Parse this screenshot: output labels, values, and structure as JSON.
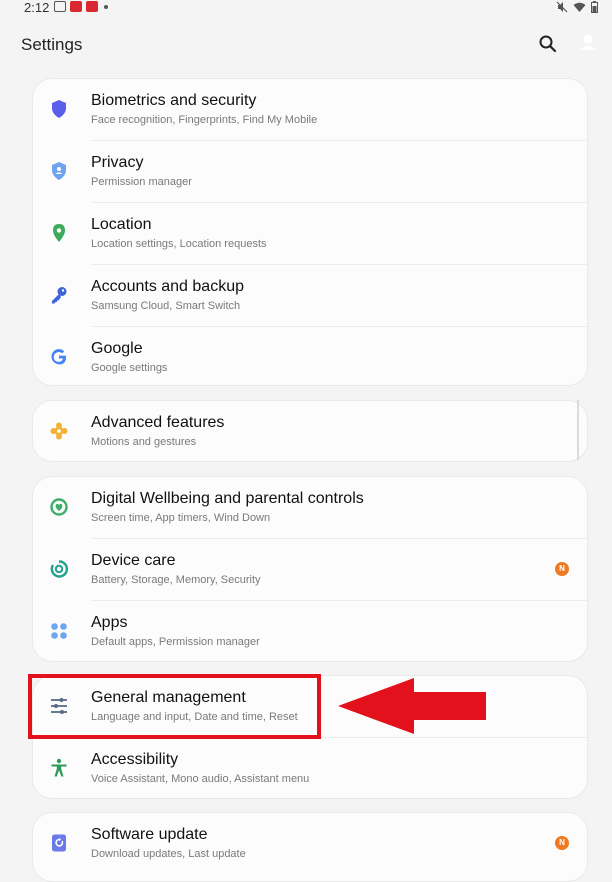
{
  "status_bar": {
    "time": "2:12"
  },
  "header": {
    "title": "Settings"
  },
  "groups": [
    {
      "items": [
        {
          "title": "Biometrics and security",
          "subtitle": "Face recognition, Fingerprints, Find My Mobile",
          "icon": "shield-icon",
          "color": "#5b5ee8"
        },
        {
          "title": "Privacy",
          "subtitle": "Permission manager",
          "icon": "privacy-shield-icon",
          "color": "#6ea4f0"
        },
        {
          "title": "Location",
          "subtitle": "Location settings, Location requests",
          "icon": "location-pin-icon",
          "color": "#3daa5c"
        },
        {
          "title": "Accounts and backup",
          "subtitle": "Samsung Cloud, Smart Switch",
          "icon": "key-icon",
          "color": "#3f63d8"
        },
        {
          "title": "Google",
          "subtitle": "Google settings",
          "icon": "google-icon",
          "color": "#4285f4"
        }
      ]
    },
    {
      "items": [
        {
          "title": "Advanced features",
          "subtitle": "Motions and gestures",
          "icon": "puzzle-gear-icon",
          "color": "#f2b233"
        }
      ]
    },
    {
      "items": [
        {
          "title": "Digital Wellbeing and parental controls",
          "subtitle": "Screen time, App timers, Wind Down",
          "icon": "wellbeing-icon",
          "color": "#3dae6a"
        },
        {
          "title": "Device care",
          "subtitle": "Battery, Storage, Memory, Security",
          "icon": "device-care-icon",
          "color": "#21a28a",
          "badge": "N"
        },
        {
          "title": "Apps",
          "subtitle": "Default apps, Permission manager",
          "icon": "apps-grid-icon",
          "color": "#6ea4f0"
        }
      ]
    },
    {
      "items": [
        {
          "title": "General management",
          "subtitle": "Language and input, Date and time, Reset",
          "icon": "sliders-icon",
          "color": "#5a6b86"
        },
        {
          "title": "Accessibility",
          "subtitle": "Voice Assistant, Mono audio, Assistant menu",
          "icon": "accessibility-icon",
          "color": "#2f9a55"
        }
      ]
    },
    {
      "items": [
        {
          "title": "Software update",
          "subtitle": "Download updates, Last update",
          "icon": "software-update-icon",
          "color": "#6a7ae8",
          "badge": "N"
        }
      ]
    }
  ],
  "annotation": {
    "highlight_color": "#e3111c"
  }
}
